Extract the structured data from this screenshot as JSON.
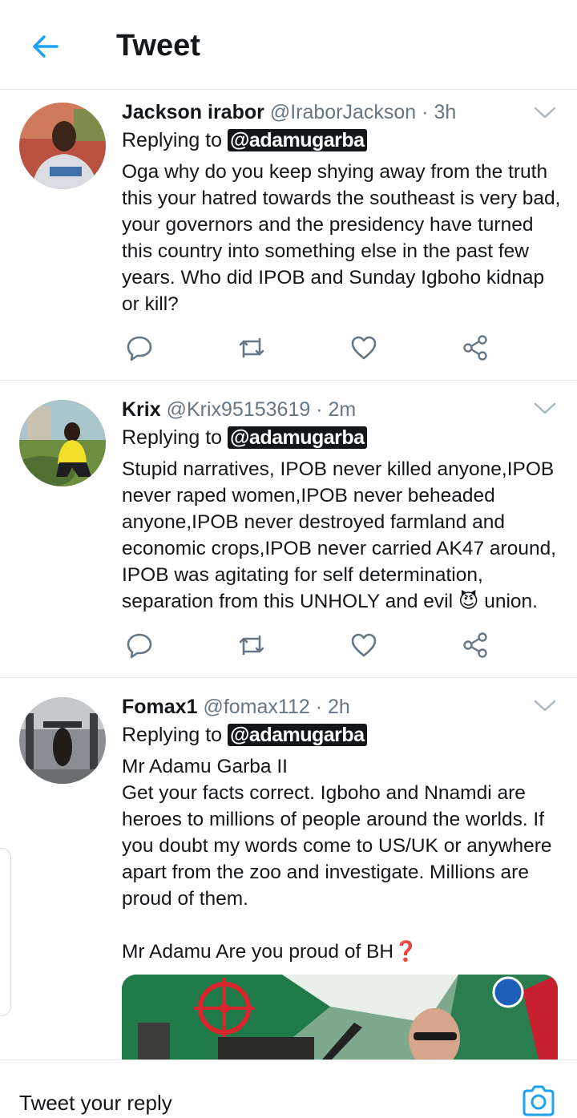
{
  "header": {
    "title": "Tweet",
    "back_icon": "arrow-left-icon"
  },
  "accent_color": "#1da1f2",
  "tweets": [
    {
      "name": "Jackson irabor",
      "handle": "@IraborJackson",
      "time": "· 3h",
      "replying_label": "Replying to",
      "mention": "@adamugarba",
      "text": "Oga why do you keep shying away from the truth this your hatred towards the southeast is very bad,  your governors and the presidency have turned this country into something else in the past few years. Who did IPOB and Sunday Igboho kidnap or kill?"
    },
    {
      "name": "Krix",
      "handle": "@Krix95153619",
      "time": "· 2m",
      "replying_label": "Replying to",
      "mention": "@adamugarba",
      "text": "Stupid narratives, IPOB never killed anyone,IPOB never raped women,IPOB never beheaded anyone,IPOB never destroyed farmland and economic crops,IPOB never carried AK47 around, IPOB was agitating for self determination, separation from this UNHOLY and evil 😈 union."
    },
    {
      "name": "Fomax1",
      "handle": "@fomax112",
      "time": "· 2h",
      "replying_label": "Replying to",
      "mention": "@adamugarba",
      "text": "Mr Adamu Garba II\nGet your facts correct. Igboho and Nnamdi are heroes to millions of people around the worlds. If you doubt my words come to US/UK or anywhere apart from the zoo and investigate. Millions are proud of them.\n\nMr Adamu Are you proud of BH❓"
    }
  ],
  "action_icons": [
    "reply-icon",
    "retweet-icon",
    "like-icon",
    "share-icon"
  ],
  "reply_bar": {
    "placeholder": "Tweet your reply",
    "icon": "camera-icon"
  }
}
